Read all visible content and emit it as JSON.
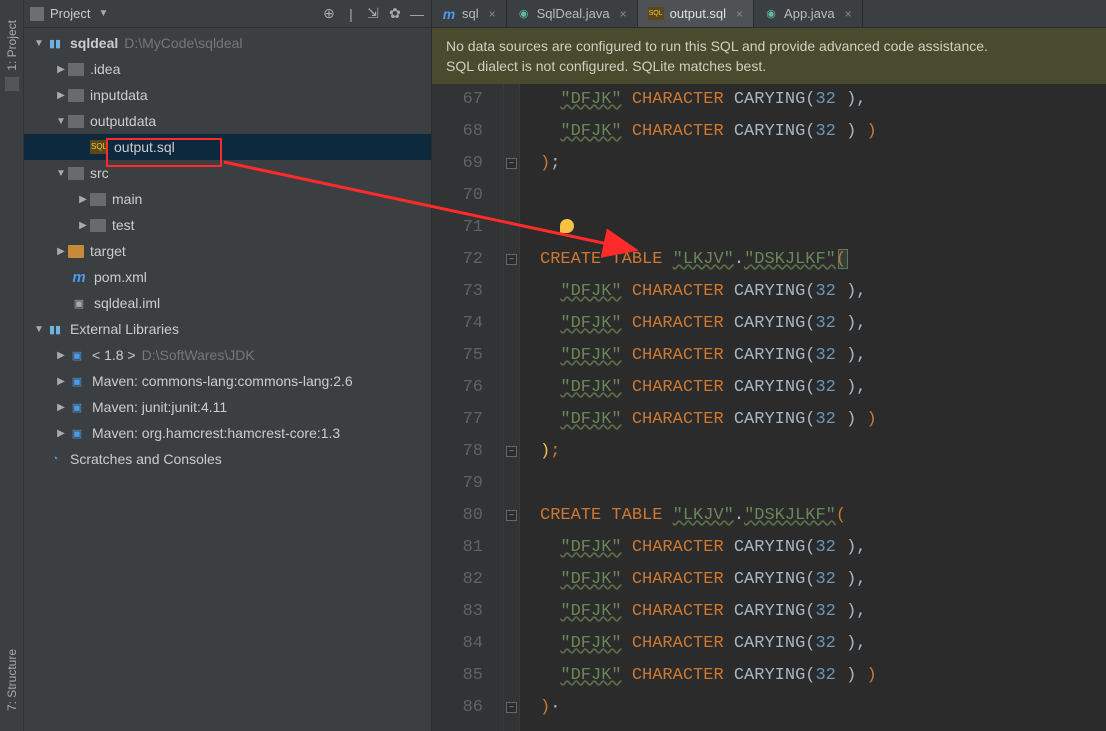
{
  "leftGutter": {
    "top": "1: Project",
    "bottom": "7: Structure"
  },
  "sidebar": {
    "title": "Project",
    "project": {
      "name": "sqldeal",
      "path": "D:\\MyCode\\sqldeal"
    },
    "nodes": {
      "idea": ".idea",
      "inputdata": "inputdata",
      "outputdata": "outputdata",
      "outputsql": "output.sql",
      "src": "src",
      "main": "main",
      "test": "test",
      "target": "target",
      "pom": "pom.xml",
      "iml": "sqldeal.iml",
      "extlib": "External Libraries",
      "jdk": "< 1.8 >",
      "jdkpath": "D:\\SoftWares\\JDK",
      "mvn1": "Maven: commons-lang:commons-lang:2.6",
      "mvn2": "Maven: junit:junit:4.11",
      "mvn3": "Maven: org.hamcrest:hamcrest-core:1.3",
      "scratches": "Scratches and Consoles"
    }
  },
  "tabs": [
    {
      "label": "sql",
      "iconType": "m",
      "active": false
    },
    {
      "label": "SqlDeal.java",
      "iconType": "java",
      "active": false
    },
    {
      "label": "output.sql",
      "iconType": "sql",
      "active": true
    },
    {
      "label": "App.java",
      "iconType": "java",
      "active": false
    }
  ],
  "banner": {
    "line1": "No data sources are configured to run this SQL and provide advanced code assistance.",
    "line2a": "SQL dialect is not configured. ",
    "line2b": "SQLite",
    "line2c": " matches best."
  },
  "code": {
    "startLine": 67,
    "lines": [
      {
        "n": 67,
        "indent": 1,
        "c": "col"
      },
      {
        "n": 68,
        "indent": 1,
        "c": "col_end"
      },
      {
        "n": 69,
        "indent": 0,
        "c": "close"
      },
      {
        "n": 70,
        "indent": 0,
        "c": "blank"
      },
      {
        "n": 71,
        "indent": 0,
        "c": "bulb"
      },
      {
        "n": 72,
        "indent": 0,
        "c": "create_hl"
      },
      {
        "n": 73,
        "indent": 1,
        "c": "col"
      },
      {
        "n": 74,
        "indent": 1,
        "c": "col"
      },
      {
        "n": 75,
        "indent": 1,
        "c": "col"
      },
      {
        "n": 76,
        "indent": 1,
        "c": "col"
      },
      {
        "n": 77,
        "indent": 1,
        "c": "col_end"
      },
      {
        "n": 78,
        "indent": 0,
        "c": "close_y"
      },
      {
        "n": 79,
        "indent": 0,
        "c": "blank"
      },
      {
        "n": 80,
        "indent": 0,
        "c": "create"
      },
      {
        "n": 81,
        "indent": 1,
        "c": "col"
      },
      {
        "n": 82,
        "indent": 1,
        "c": "col"
      },
      {
        "n": 83,
        "indent": 1,
        "c": "col"
      },
      {
        "n": 84,
        "indent": 1,
        "c": "col"
      },
      {
        "n": 85,
        "indent": 1,
        "c": "col_end"
      },
      {
        "n": 86,
        "indent": 0,
        "c": "close_partial"
      }
    ],
    "tokens": {
      "schema": "LKJV",
      "table": "DSKJLKF",
      "colname": "DFJK",
      "type": "CHARACTER",
      "fn": "CARYING",
      "size": "32",
      "create": "CREATE",
      "tablekw": "TABLE"
    }
  }
}
